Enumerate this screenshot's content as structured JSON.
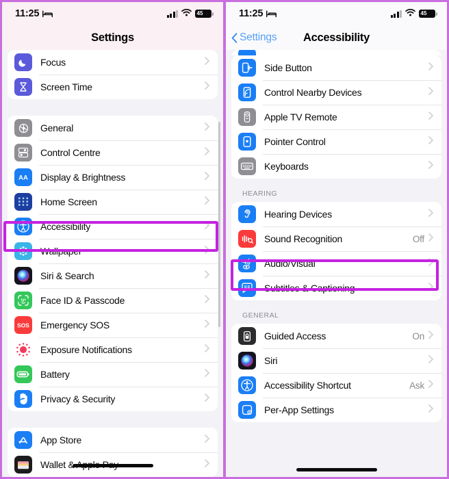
{
  "theme": {
    "highlight_color": "#c423e0",
    "frame_color": "#c86ede",
    "ios_blue": "#007aff",
    "group_bg": "#ffffff",
    "page_bg": "#f2f2f7"
  },
  "left_phone": {
    "status_bar": {
      "time": "11:25",
      "focus_icon": "bed-icon",
      "signal_icon": "cellular-bars-icon",
      "wifi_icon": "wifi-icon",
      "battery_icon": "battery-icon",
      "battery_level": "45"
    },
    "nav": {
      "title": "Settings"
    },
    "groups": [
      {
        "name": "focus-group",
        "rows": [
          {
            "label": "Focus",
            "icon": "moon-icon",
            "icon_bg": "#5a5adb",
            "value": "",
            "chevron": true
          },
          {
            "label": "Screen Time",
            "icon": "hourglass-icon",
            "icon_bg": "#5a5adb",
            "value": "",
            "chevron": true
          }
        ]
      },
      {
        "name": "system-group",
        "rows": [
          {
            "label": "General",
            "icon": "gear-icon",
            "icon_bg": "#8e8e93",
            "value": "",
            "chevron": true
          },
          {
            "label": "Control Centre",
            "icon": "control-centre-icon",
            "icon_bg": "#8e8e93",
            "value": "",
            "chevron": true
          },
          {
            "label": "Display & Brightness",
            "icon": "aa-icon",
            "icon_bg": "#1a7ef5",
            "value": "",
            "chevron": true
          },
          {
            "label": "Home Screen",
            "icon": "home-screen-grid-icon",
            "icon_bg": "#1d3fa0",
            "value": "",
            "chevron": true
          },
          {
            "label": "Accessibility",
            "icon": "accessibility-person-icon",
            "icon_bg": "#1a7ef5",
            "value": "",
            "chevron": true,
            "highlighted": true
          },
          {
            "label": "Wallpaper",
            "icon": "wallpaper-flower-icon",
            "icon_bg": "#3ab5e8",
            "value": "",
            "chevron": true
          },
          {
            "label": "Siri & Search",
            "icon": "siri-orb-icon",
            "icon_bg": "#1c1c2b",
            "value": "",
            "chevron": true
          },
          {
            "label": "Face ID & Passcode",
            "icon": "face-id-icon",
            "icon_bg": "#34c759",
            "value": "",
            "chevron": true
          },
          {
            "label": "Emergency SOS",
            "icon": "sos-icon",
            "icon_bg": "#fa3b3b",
            "value": "",
            "chevron": true
          },
          {
            "label": "Exposure Notifications",
            "icon": "exposure-dot-icon",
            "icon_bg": "#ffffff",
            "value": "",
            "chevron": true
          },
          {
            "label": "Battery",
            "icon": "battery-green-icon",
            "icon_bg": "#34c759",
            "value": "",
            "chevron": true
          },
          {
            "label": "Privacy & Security",
            "icon": "hand-icon",
            "icon_bg": "#1a7ef5",
            "value": "",
            "chevron": true
          }
        ]
      },
      {
        "name": "store-group",
        "rows": [
          {
            "label": "App Store",
            "icon": "app-store-icon",
            "icon_bg": "#1a7ef5",
            "value": "",
            "chevron": true
          },
          {
            "label": "Wallet & Apple Pay",
            "icon": "wallet-icon",
            "icon_bg": "#1c1c1e",
            "value": "",
            "chevron": true
          }
        ]
      }
    ]
  },
  "right_phone": {
    "status_bar": {
      "time": "11:25",
      "focus_icon": "bed-icon",
      "signal_icon": "cellular-bars-icon",
      "wifi_icon": "wifi-icon",
      "battery_icon": "battery-icon",
      "battery_level": "45"
    },
    "nav": {
      "back_label": "Settings",
      "title": "Accessibility"
    },
    "groups": [
      {
        "name": "physical-motor-group",
        "header": "",
        "rows": [
          {
            "label": "Side Button",
            "icon": "side-button-icon",
            "icon_bg": "#1a7ef5",
            "value": "",
            "chevron": true
          },
          {
            "label": "Control Nearby Devices",
            "icon": "nearby-devices-icon",
            "icon_bg": "#1a7ef5",
            "value": "",
            "chevron": true
          },
          {
            "label": "Apple TV Remote",
            "icon": "apple-tv-remote-icon",
            "icon_bg": "#8e8e93",
            "value": "",
            "chevron": true
          },
          {
            "label": "Pointer Control",
            "icon": "pointer-control-icon",
            "icon_bg": "#1a7ef5",
            "value": "",
            "chevron": true
          },
          {
            "label": "Keyboards",
            "icon": "keyboard-icon",
            "icon_bg": "#8e8e93",
            "value": "",
            "chevron": true
          }
        ]
      },
      {
        "name": "hearing-group",
        "header": "HEARING",
        "rows": [
          {
            "label": "Hearing Devices",
            "icon": "ear-icon",
            "icon_bg": "#1a7ef5",
            "value": "",
            "chevron": true
          },
          {
            "label": "Sound Recognition",
            "icon": "sound-recognition-icon",
            "icon_bg": "#fa3b3b",
            "value": "Off",
            "chevron": true
          },
          {
            "label": "Audio/Visual",
            "icon": "audio-visual-icon",
            "icon_bg": "#1a7ef5",
            "value": "",
            "chevron": true,
            "highlighted": true
          },
          {
            "label": "Subtitles & Captioning",
            "icon": "subtitles-icon",
            "icon_bg": "#1a7ef5",
            "value": "",
            "chevron": true
          }
        ]
      },
      {
        "name": "general-group",
        "header": "GENERAL",
        "rows": [
          {
            "label": "Guided Access",
            "icon": "guided-access-lock-icon",
            "icon_bg": "#2c2c2e",
            "value": "On",
            "chevron": true
          },
          {
            "label": "Siri",
            "icon": "siri-orb-icon",
            "icon_bg": "#1c1c2b",
            "value": "",
            "chevron": true
          },
          {
            "label": "Accessibility Shortcut",
            "icon": "accessibility-person-icon",
            "icon_bg": "#1a7ef5",
            "value": "Ask",
            "chevron": true
          },
          {
            "label": "Per-App Settings",
            "icon": "per-app-settings-icon",
            "icon_bg": "#1a7ef5",
            "value": "",
            "chevron": true
          }
        ]
      }
    ]
  }
}
